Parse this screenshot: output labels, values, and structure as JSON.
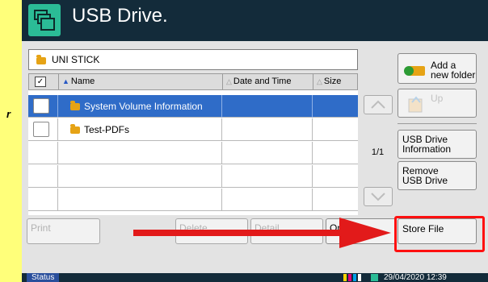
{
  "header": {
    "title": "USB Drive.",
    "icon": "folder-stack-icon"
  },
  "path": {
    "label": "UNI STICK"
  },
  "table": {
    "columns": {
      "name": "Name",
      "date": "Date and Time",
      "size": "Size"
    },
    "rows": [
      {
        "name": "System Volume Information",
        "selected": true
      },
      {
        "name": "Test-PDFs",
        "selected": false
      }
    ],
    "page_indicator": "1/1"
  },
  "right_panel": {
    "add_folder_line1": "Add a",
    "add_folder_line2": "new folder",
    "up": "Up",
    "usb_info_line1": "USB Drive",
    "usb_info_line2": "Information",
    "remove_line1": "Remove",
    "remove_line2": "USB Drive",
    "store_file": "Store File"
  },
  "bottom_buttons": {
    "print": "Print",
    "delete": "Delete",
    "detail": "Detail",
    "open": "Open"
  },
  "status_bar": {
    "status": "Status",
    "datetime": "29/04/2020 12:39"
  },
  "colors": {
    "titlebar": "#132b3a",
    "accent": "#2bbc96",
    "selection": "#2f6cc8",
    "annotation": "#e21a1a"
  }
}
